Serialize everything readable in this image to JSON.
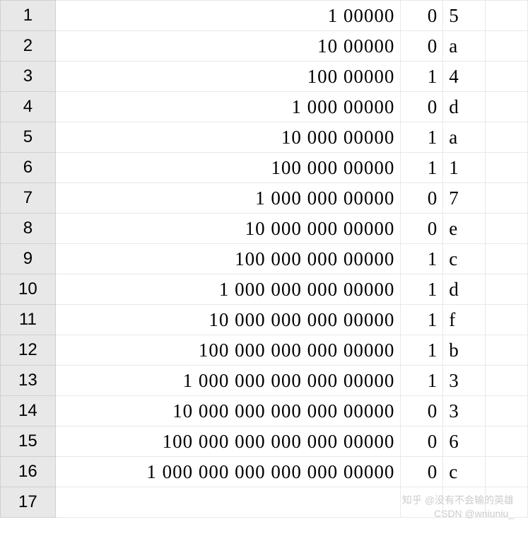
{
  "rows": [
    {
      "n": "1",
      "a": "1 00000",
      "b": "0",
      "c": "5"
    },
    {
      "n": "2",
      "a": "10 00000",
      "b": "0",
      "c": "a"
    },
    {
      "n": "3",
      "a": "100 00000",
      "b": "1",
      "c": "4"
    },
    {
      "n": "4",
      "a": "1 000 00000",
      "b": "0",
      "c": "d"
    },
    {
      "n": "5",
      "a": "10 000 00000",
      "b": "1",
      "c": "a"
    },
    {
      "n": "6",
      "a": "100 000 00000",
      "b": "1",
      "c": "1"
    },
    {
      "n": "7",
      "a": "1 000 000 00000",
      "b": "0",
      "c": "7"
    },
    {
      "n": "8",
      "a": "10 000 000 00000",
      "b": "0",
      "c": "e"
    },
    {
      "n": "9",
      "a": "100 000 000 00000",
      "b": "1",
      "c": "c"
    },
    {
      "n": "10",
      "a": "1 000 000 000 00000",
      "b": "1",
      "c": "d"
    },
    {
      "n": "11",
      "a": "10 000 000 000 00000",
      "b": "1",
      "c": "f"
    },
    {
      "n": "12",
      "a": "100 000 000 000 00000",
      "b": "1",
      "c": "b"
    },
    {
      "n": "13",
      "a": "1 000 000 000 000 00000",
      "b": "1",
      "c": "3"
    },
    {
      "n": "14",
      "a": "10 000 000 000 000 00000",
      "b": "0",
      "c": "3"
    },
    {
      "n": "15",
      "a": "100 000 000 000 000 00000",
      "b": "0",
      "c": "6"
    },
    {
      "n": "16",
      "a": "1 000 000 000 000 000 00000",
      "b": "0",
      "c": "c"
    },
    {
      "n": "17",
      "a": "",
      "b": "",
      "c": ""
    }
  ],
  "watermark": {
    "line1": "知乎 @没有不会输的英雄",
    "line2": "CSDN @wniuniu_"
  }
}
